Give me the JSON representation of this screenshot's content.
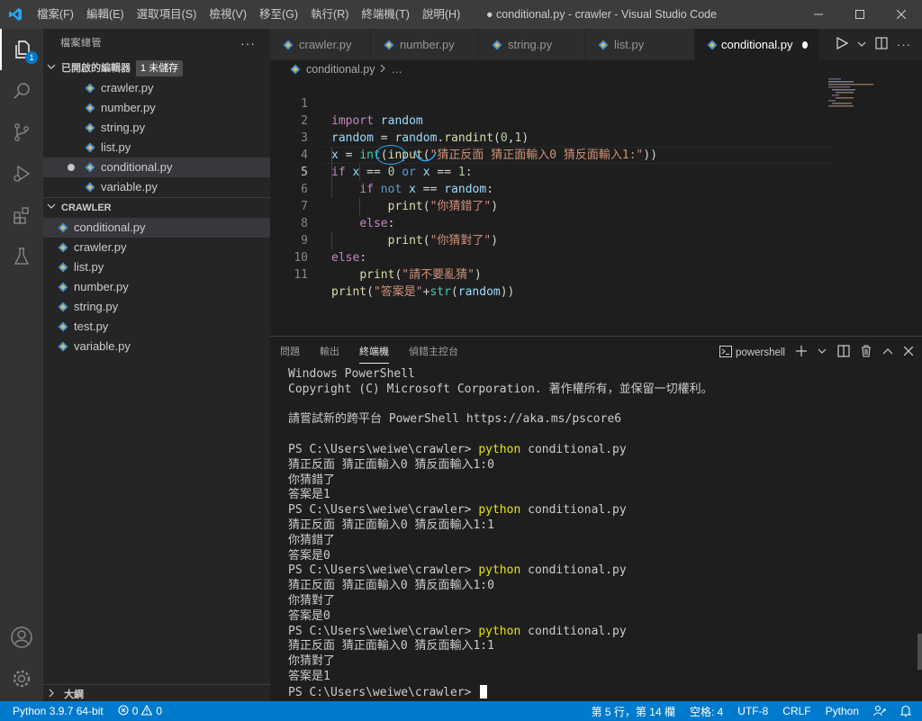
{
  "titlebar": {
    "menus": [
      "檔案(F)",
      "編輯(E)",
      "選取項目(S)",
      "檢視(V)",
      "移至(G)",
      "執行(R)",
      "終端機(T)",
      "說明(H)"
    ],
    "title": "● conditional.py - crawler - Visual Studio Code"
  },
  "activity": {
    "explorer_badge": "1"
  },
  "sidebar": {
    "title": "檔案總管",
    "open_editors": {
      "label": "已開啟的編輯器",
      "badge": "1 未儲存",
      "files": [
        "crawler.py",
        "number.py",
        "string.py",
        "list.py",
        "conditional.py",
        "variable.py"
      ]
    },
    "folder": {
      "label": "CRAWLER",
      "files": [
        "conditional.py",
        "crawler.py",
        "list.py",
        "number.py",
        "string.py",
        "test.py",
        "variable.py"
      ]
    },
    "outline": "大綱"
  },
  "tabs": [
    "crawler.py",
    "number.py",
    "string.py",
    "list.py",
    "conditional.py"
  ],
  "breadcrumb": {
    "file": "conditional.py",
    "rest": "…"
  },
  "editor": {
    "line_numbers": [
      "1",
      "2",
      "3",
      "4",
      "5",
      "6",
      "7",
      "8",
      "9",
      "10",
      "11"
    ],
    "current_line": 5
  },
  "panel": {
    "tabs": [
      "問題",
      "輸出",
      "終端機",
      "偵錯主控台"
    ],
    "active_tab": "終端機",
    "shell": "powershell",
    "prompt": "PS C:\\Users\\weiwe\\crawler>",
    "command_word": "python",
    "command_arg": " conditional.py",
    "banner": [
      "Windows PowerShell",
      "Copyright (C) Microsoft Corporation. 著作權所有，並保留一切權利。",
      "",
      "請嘗試新的跨平台 PowerShell https://aka.ms/pscore6",
      ""
    ],
    "runs": [
      [
        "猜正反面 猜正面輸入0 猜反面輸入1:0",
        "你猜錯了",
        "答案是1"
      ],
      [
        "猜正反面 猜正面輸入0 猜反面輸入1:1",
        "你猜錯了",
        "答案是0"
      ],
      [
        "猜正反面 猜正面輸入0 猜反面輸入1:0",
        "你猜對了",
        "答案是0"
      ],
      [
        "猜正反面 猜正面輸入0 猜反面輸入1:1",
        "你猜對了",
        "答案是1"
      ]
    ]
  },
  "statusbar": {
    "python": "Python 3.9.7 64-bit",
    "errors": "0",
    "warnings": "0",
    "position": "第 5 行，第 14 欄",
    "spaces": "空格: 4",
    "encoding": "UTF-8",
    "eol": "CRLF",
    "language": "Python"
  }
}
